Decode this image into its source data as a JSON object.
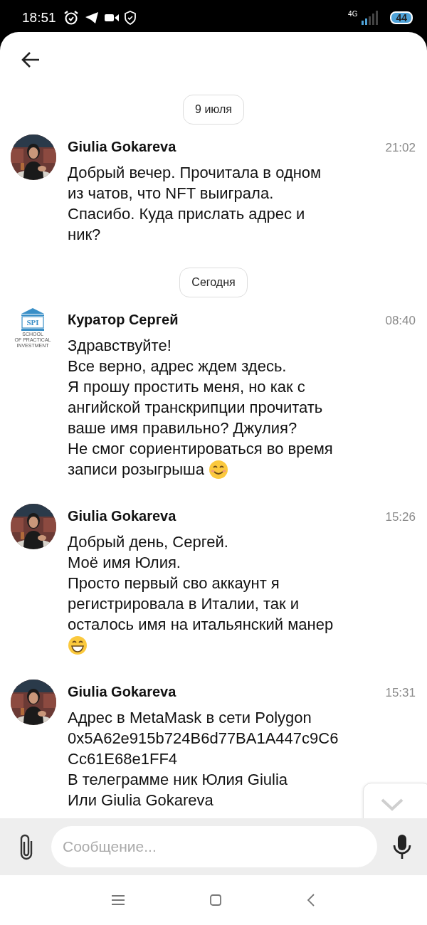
{
  "status_bar": {
    "time": "18:51",
    "network": "4G",
    "battery": "44"
  },
  "chat": [
    {
      "kind": "date",
      "label": "9 июля"
    },
    {
      "kind": "message",
      "author": "Giulia Gokareva",
      "time": "21:02",
      "text": "Добрый вечер. Прочитала в одном\nиз чатов, что NFT выиграла.\nСпасибо. Куда прислать адрес и\nник?"
    },
    {
      "kind": "date",
      "label": "Сегодня"
    },
    {
      "kind": "message",
      "avatar": {
        "kind": "logo",
        "mark": "SPI",
        "lines": [
          "SCHOOL",
          "OF PRACTICAL",
          "INVESTMENT"
        ]
      },
      "author": "Куратор Сергей",
      "time": "08:40",
      "text": "Здравствуйте!\nВсе верно, адрес ждем здесь.\nЯ прошу простить меня, но как с\nангийской транскрипции прочитать\nваше имя правильно? Джулия?\nНе смог сориентироваться во время",
      "text_end": "записи розыгрыша",
      "emoji": {
        "kind": "smile"
      }
    },
    {
      "kind": "message",
      "author": "Giulia Gokareva",
      "time": "15:26",
      "text": "Добрый день, Сергей.\nМоё имя Юлия.\nПросто первый сво аккаунт я\nрегистрировала в Италии, так и\nосталось имя на итальянский манер",
      "emoji": {
        "kind": "grin"
      }
    },
    {
      "kind": "message",
      "author": "Giulia Gokareva",
      "time": "15:31",
      "text": "Адрес в MetaMask в сети Polygon\n0x5A62e915b724B6d77BA1A447c9C6\nCc61E68e1FF4\nВ телеграмме ник Юлия Giulia\nИли Giulia Gokareva"
    }
  ],
  "composer": {
    "placeholder": "Сообщение..."
  }
}
